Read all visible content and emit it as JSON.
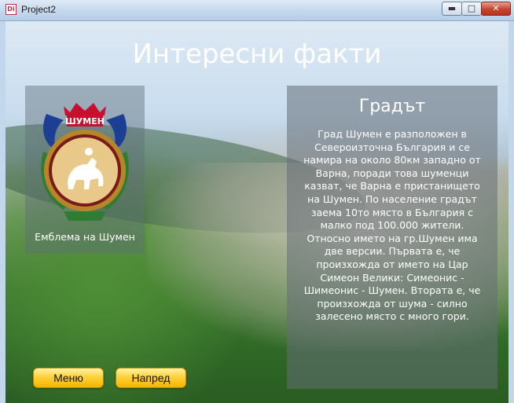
{
  "window": {
    "title": "Project2",
    "app_icon_text": "Di",
    "minimize_glyph": "▬",
    "maximize_glyph": "□",
    "close_glyph": "✕"
  },
  "page": {
    "title": "Интересни факти"
  },
  "emblem": {
    "banner_text": "ШУМЕН",
    "caption": "Емблема на Шумен"
  },
  "info": {
    "heading": "Градът",
    "body": "Град Шумен е разположен в Североизточна България и се намира на около 80км западно от Варна, поради това шуменци казват, че Варна е пристанището на Шумен. По население градът заема 10то място в България с малко под 100.000 жители.  Относно името на гр.Шумен има две версии. Първата е, че произхожда от името на Цар Симеон Велики: Симеонис - Шимеонис - Шумен. Втората е, че произхожда от шума - силно залесено място с много гори."
  },
  "buttons": {
    "menu": "Меню",
    "next": "Напред"
  },
  "colors": {
    "button_gold": "#ffd23a",
    "emblem_red": "#c8102e",
    "emblem_blue": "#1c3f94",
    "emblem_green": "#2e7d32",
    "emblem_gold": "#d4a23a"
  }
}
